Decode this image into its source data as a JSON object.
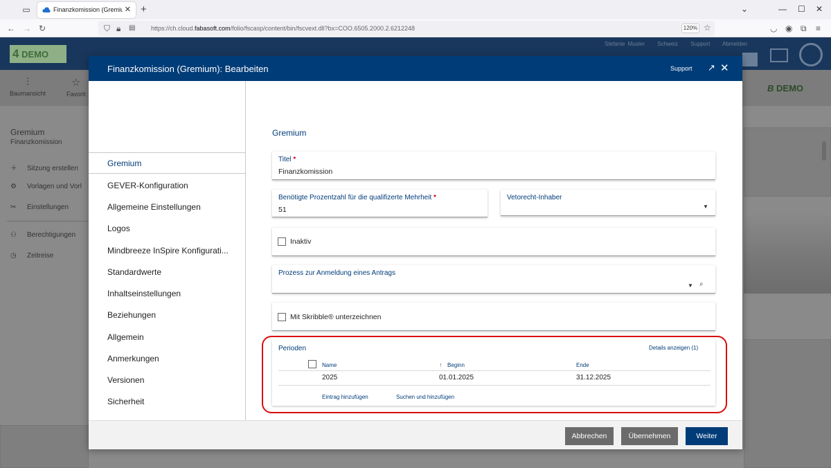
{
  "browser": {
    "tab_title": "Finanzkomission (Gremium): Be",
    "url_prefix": "https://ch.cloud.",
    "url_domain": "fabasoft.com",
    "url_suffix": "/folio/fscasp/content/bin/fscvext.dll?bx=COO.6505.2000.2.6212248",
    "zoom": "120%"
  },
  "app": {
    "logo_left": "DEMO",
    "logo_right": "DEMO",
    "header_links": [
      "Stefanie Muster",
      "Schweiz",
      "Support",
      "Abmelden"
    ],
    "toolbar": [
      "Baumansicht",
      "Favorit"
    ],
    "bg_heading": "Gremium",
    "bg_subheading": "Finanzkomission",
    "bg_menu": [
      "Sitzung erstellen",
      "Vorlagen und Vorl",
      "Einstellungen",
      "Berechtigungen",
      "Zeitreise"
    ]
  },
  "dialog": {
    "title": "Finanzkomission (Gremium): Bearbeiten",
    "support": "Support",
    "sidebar": [
      {
        "label": "Gremium"
      },
      {
        "label": "GEVER-Konfiguration"
      },
      {
        "label": "Allgemeine Einstellungen"
      },
      {
        "label": "Logos"
      },
      {
        "label": "Mindbreeze InSpire Konfigurati..."
      },
      {
        "label": "Standardwerte"
      },
      {
        "label": "Inhaltseinstellungen"
      },
      {
        "label": "Beziehungen"
      },
      {
        "label": "Allgemein"
      },
      {
        "label": "Anmerkungen"
      },
      {
        "label": "Versionen"
      },
      {
        "label": "Sicherheit"
      }
    ],
    "section_title": "Gremium",
    "fields": {
      "titel_label": "Titel",
      "titel_value": "Finanzkomission",
      "prozent_label": "Benötigte Prozentzahl für die qualifizerte Mehrheit",
      "prozent_value": "51",
      "veto_label": "Vetorecht-Inhaber",
      "veto_value": "",
      "inaktiv_label": "Inaktiv",
      "prozess_label": "Prozess zur Anmeldung eines Antrags",
      "prozess_value": "",
      "skribble_label": "Mit Skribble® unterzeichnen"
    },
    "perioden": {
      "title": "Perioden",
      "details": "Details anzeigen (1)",
      "columns": [
        "Name",
        "Beginn",
        "Ende"
      ],
      "rows": [
        {
          "name": "2025",
          "beginn": "01.01.2025",
          "ende": "31.12.2025"
        }
      ],
      "add_link": "Eintrag hinzufügen",
      "search_link": "Suchen und hinzufügen"
    },
    "buttons": {
      "cancel": "Abbrechen",
      "apply": "Übernehmen",
      "next": "Weiter"
    }
  },
  "colors": {
    "primary": "#003c78",
    "required": "#d0021b",
    "highlight": "#d80d0d"
  }
}
